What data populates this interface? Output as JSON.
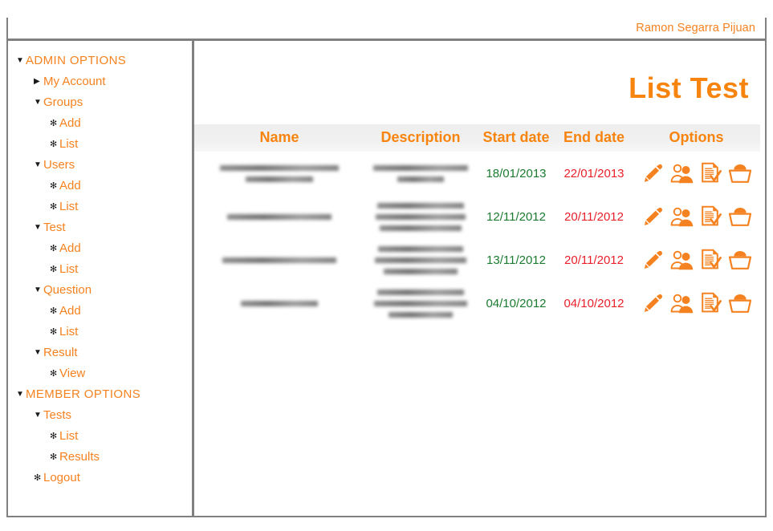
{
  "topbar": {
    "user_name": "Ramon Segarra Pijuan"
  },
  "page": {
    "title": "List Test"
  },
  "sidebar": {
    "items": [
      {
        "label": "ADMIN OPTIONS",
        "level": 0,
        "marker": "caret-down-icon"
      },
      {
        "label": "My Account",
        "level": 1,
        "marker": "caret-right-icon"
      },
      {
        "label": "Groups",
        "level": 1,
        "marker": "caret-down-icon"
      },
      {
        "label": "Add",
        "level": 2,
        "marker": "bullet-dot-icon"
      },
      {
        "label": "List",
        "level": 2,
        "marker": "bullet-dot-icon"
      },
      {
        "label": "Users",
        "level": 1,
        "marker": "caret-down-icon"
      },
      {
        "label": "Add",
        "level": 2,
        "marker": "bullet-dot-icon"
      },
      {
        "label": "List",
        "level": 2,
        "marker": "bullet-dot-icon"
      },
      {
        "label": "Test",
        "level": 1,
        "marker": "caret-down-icon"
      },
      {
        "label": "Add",
        "level": 2,
        "marker": "bullet-dot-icon"
      },
      {
        "label": "List",
        "level": 2,
        "marker": "bullet-dot-icon"
      },
      {
        "label": "Question",
        "level": 1,
        "marker": "caret-down-icon"
      },
      {
        "label": "Add",
        "level": 2,
        "marker": "bullet-dot-icon"
      },
      {
        "label": "List",
        "level": 2,
        "marker": "bullet-dot-icon"
      },
      {
        "label": "Result",
        "level": 1,
        "marker": "caret-down-icon"
      },
      {
        "label": "View",
        "level": 2,
        "marker": "bullet-dot-icon"
      },
      {
        "label": "MEMBER OPTIONS",
        "level": 0,
        "marker": "caret-down-icon"
      },
      {
        "label": "Tests",
        "level": 1,
        "marker": "caret-down-icon"
      },
      {
        "label": "List",
        "level": 2,
        "marker": "bullet-dot-icon"
      },
      {
        "label": "Results",
        "level": 2,
        "marker": "bullet-dot-icon"
      },
      {
        "label": "Logout",
        "level": 1,
        "marker": "bullet-dot-icon"
      }
    ]
  },
  "table": {
    "columns": [
      "Name",
      "Description",
      "Start date",
      "End date",
      "Options"
    ],
    "row_options_icons": [
      "edit-pencil-icon",
      "assign-users-icon",
      "view-results-icon",
      "delete-basket-icon"
    ],
    "rows": [
      {
        "name": "",
        "name_redacted": true,
        "name_bars": [
          148,
          84
        ],
        "description": "",
        "description_redacted": true,
        "description_bars": [
          118,
          58
        ],
        "start_date": "18/01/2013",
        "end_date": "22/01/2013"
      },
      {
        "name": "",
        "name_redacted": true,
        "name_bars": [
          130
        ],
        "description": "",
        "description_redacted": true,
        "description_bars": [
          108,
          112,
          102
        ],
        "start_date": "12/11/2012",
        "end_date": "20/11/2012"
      },
      {
        "name": "",
        "name_redacted": true,
        "name_bars": [
          142
        ],
        "description": "",
        "description_redacted": true,
        "description_bars": [
          106,
          114,
          92
        ],
        "start_date": "13/11/2012",
        "end_date": "20/11/2012"
      },
      {
        "name": "",
        "name_redacted": true,
        "name_bars": [
          96
        ],
        "description": "",
        "description_redacted": true,
        "description_bars": [
          108,
          116,
          80
        ],
        "start_date": "04/10/2012",
        "end_date": "04/10/2012"
      }
    ]
  },
  "colors": {
    "accent_orange": "#F58220",
    "title_orange": "#F7840F",
    "start_date_green": "#1B7B2F",
    "end_date_red": "#E8202A",
    "border_gray": "#808080",
    "header_band": "#f0f0f0"
  }
}
